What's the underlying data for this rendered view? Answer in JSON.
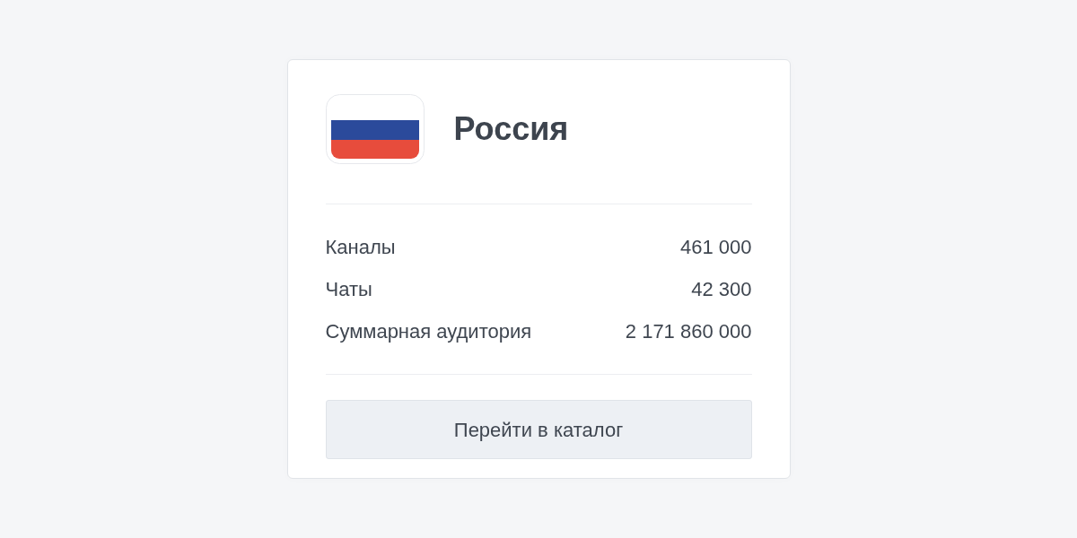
{
  "country": {
    "name": "Россия"
  },
  "stats": [
    {
      "label": "Каналы",
      "value": "461 000"
    },
    {
      "label": "Чаты",
      "value": "42 300"
    },
    {
      "label": "Суммарная аудитория",
      "value": "2 171 860 000"
    }
  ],
  "button": {
    "label": "Перейти в каталог"
  }
}
